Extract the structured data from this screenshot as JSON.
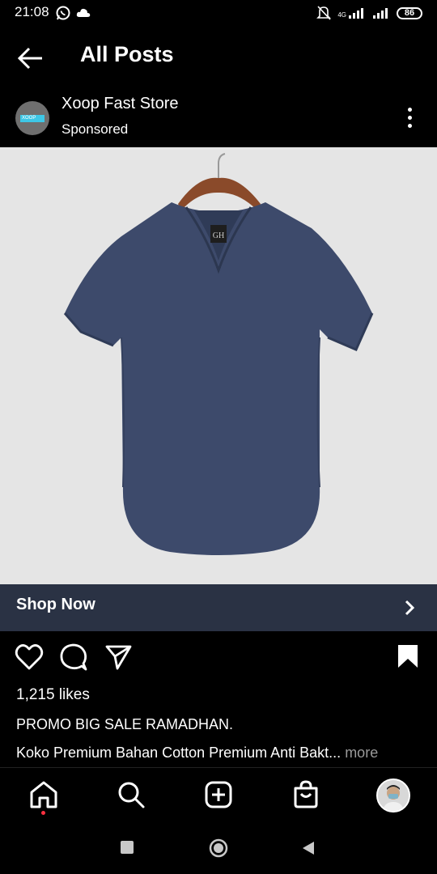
{
  "status_bar": {
    "time": "21:08",
    "battery": "86",
    "network": "4G"
  },
  "header": {
    "title": "All Posts"
  },
  "post": {
    "store_name": "Xoop Fast Store",
    "sponsored_label": "Sponsored",
    "avatar_logo_text": "XOOP",
    "shirt_tag": "GH",
    "shop_now_label": "Shop Now",
    "likes_text": "1,215 likes",
    "caption_line1": "PROMO BIG SALE RAMADHAN.",
    "caption_line2": "Koko Premium Bahan Cotton Premium Anti Bakt...",
    "more_label": " more"
  },
  "colors": {
    "background": "#000000",
    "shop_bar": "#2a3244",
    "image_bg": "#e5e5e5",
    "shirt": "#3d4a6b",
    "notification_dot": "#ff3040"
  },
  "icons": {
    "back": "arrow-left-icon",
    "more": "more-vertical-icon",
    "like": "heart-icon",
    "comment": "comment-icon",
    "share": "send-icon",
    "save": "bookmark-icon",
    "home": "home-icon",
    "search": "search-icon",
    "add": "add-post-icon",
    "shop": "shopping-bag-icon"
  }
}
